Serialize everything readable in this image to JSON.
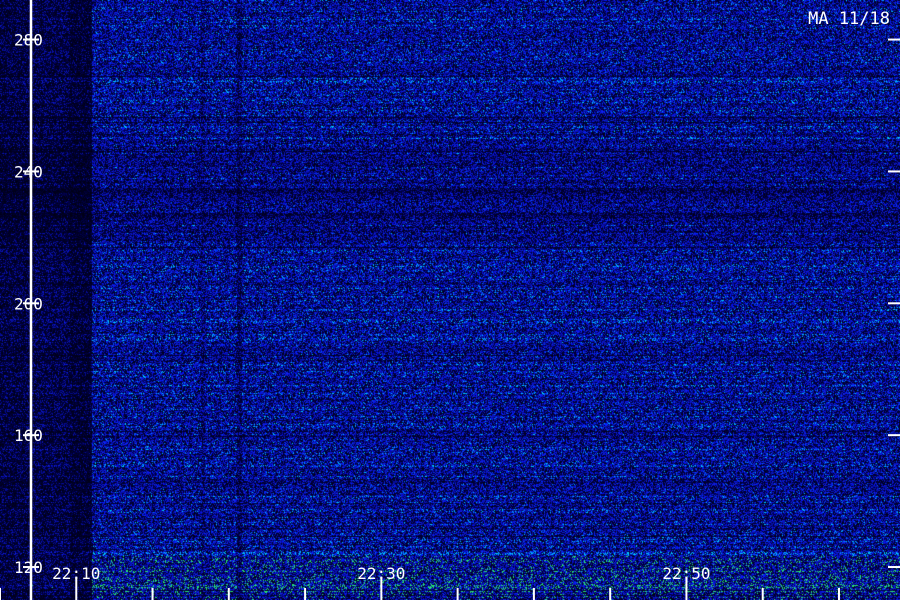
{
  "station_label": "MA 11/18",
  "colors": {
    "background": "#000000",
    "signal_low": "#000022",
    "signal_mid": "#1a2fd0",
    "signal_high": "#00e0ff",
    "axis": "#ffffff"
  },
  "chart_data": {
    "type": "heatmap",
    "title": "",
    "xlabel": "",
    "ylabel": "",
    "ylim": [
      110,
      292
    ],
    "xlim": [
      "22:05",
      "23:04"
    ],
    "y_ticks": [
      120,
      160,
      200,
      240,
      280
    ],
    "y_tick_labels": [
      "120",
      "160",
      "200",
      "240",
      "280"
    ],
    "x_ticks": [
      "22:10",
      "22:30",
      "22:50"
    ],
    "x_tick_labels": [
      "22:10",
      "22:30",
      "22:50"
    ],
    "x_minor_ticks_minutes": 5,
    "y_minor_ticks": [],
    "grid": false,
    "legend": "none"
  }
}
